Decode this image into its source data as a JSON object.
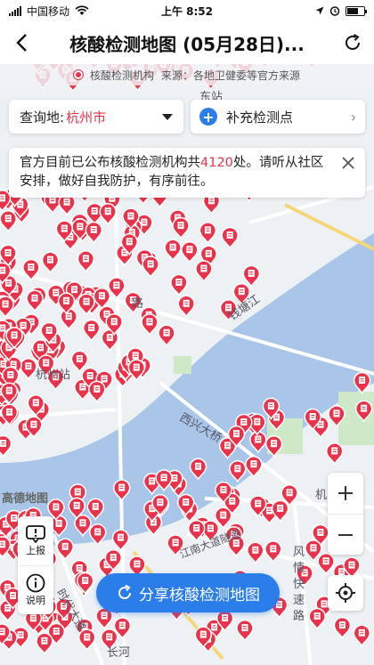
{
  "status_bar": {
    "carrier": "中国移动",
    "time": "上午 8:52"
  },
  "nav": {
    "title": "核酸检测地图 (05月28日)..."
  },
  "source": {
    "legend_label": "核酸检测机构",
    "source_text": "来源：各地卫健委等官方来源"
  },
  "query": {
    "label": "查询地:",
    "value": "杭州市"
  },
  "supplement": {
    "label": "补充检测点"
  },
  "notice": {
    "text_before": "官方目前已公布核酸检测机构共",
    "count": "4120",
    "text_after": "处。请听从社区安排，做好自我防护，有序前往。"
  },
  "map": {
    "labels": {
      "station": "杭州站",
      "river": "钱塘江",
      "bridge": "西兴大桥",
      "tunnel": "江南大道隧道",
      "express": "风情快速路",
      "avenue": "时代大道",
      "changhe": "长河",
      "road": "路",
      "dongzhan": "东站",
      "ji": "机"
    },
    "logo": "高德地图",
    "pin_color": "#e8334a"
  },
  "tools": {
    "report": "上报",
    "help": "说明"
  },
  "share": {
    "label": "分享核酸检测地图"
  },
  "colors": {
    "accent": "#e8334a",
    "brand": "#2b7de9"
  }
}
